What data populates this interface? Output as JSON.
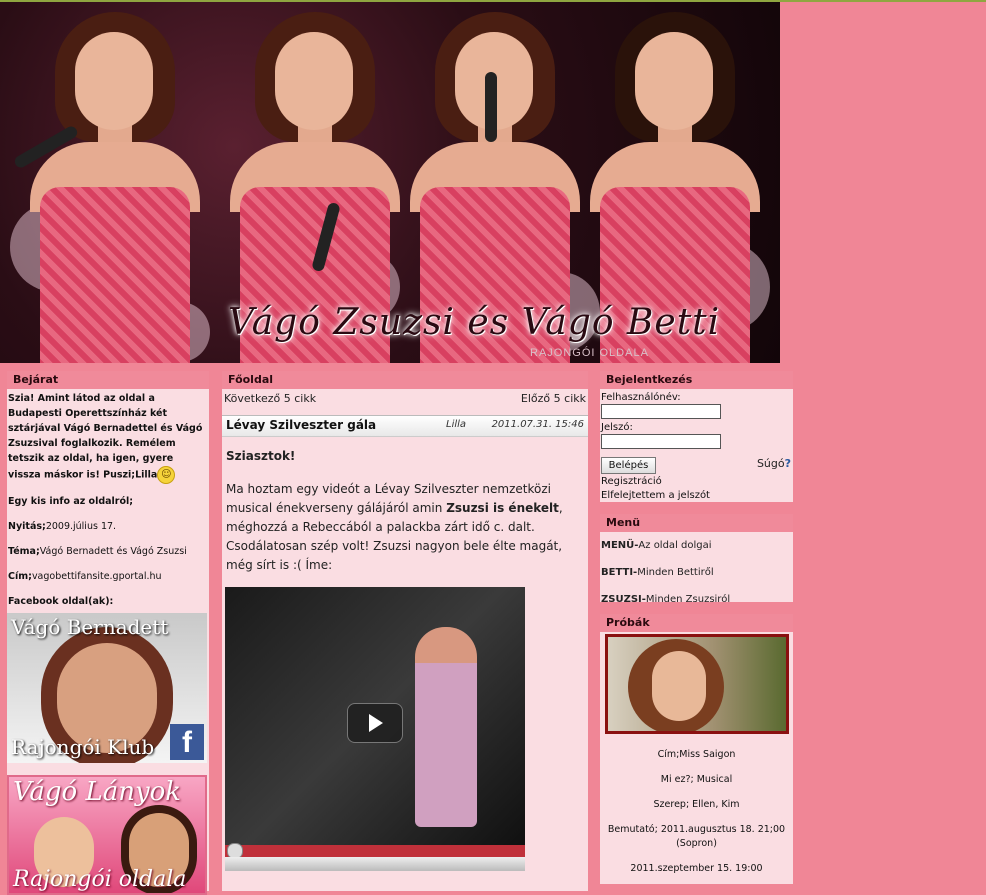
{
  "banner": {
    "title": "Vágó Zsuzsi és Vágó Betti",
    "subtitle": "RAJONGÓI OLDALA"
  },
  "left": {
    "heading": "Bejárat",
    "intro": "Szia! Amint látod az oldal a Budapesti Operettszínház két sztárjával Vágó Bernadettel és Vágó Zsuzsival foglalkozik. Remélem tetszik az oldal, ha igen, gyere vissza máskor is! Puszi;Lilla",
    "info_title": "Egy kis info az oldalról;",
    "opening_label": "Nyitás;",
    "opening_value": "2009.július 17.",
    "theme_label": "Téma;",
    "theme_value": "Vágó Bernadett és Vágó Zsuzsi",
    "address_label": "Cím;",
    "address_value": "vagobettifansite.gportal.hu",
    "facebook_label": "Facebook oldal(ak):",
    "fb1_top": "Vágó Bernadett",
    "fb1_bottom": "Rajongói Klub",
    "fb2_top": "Vágó Lányok",
    "fb2_bottom": "Rajongói oldala"
  },
  "main": {
    "heading": "Főoldal",
    "next_label": "Következő 5 cikk",
    "prev_label": "Előző 5 cikk",
    "post": {
      "title": "Lévay Szilveszter gála",
      "author": "Lilla",
      "date": "2011.07.31. 15:46",
      "greeting": "Sziasztok!",
      "body_before": "Ma hoztam egy videót a Lévay Szilveszter nemzetközi musical énekverseny gálájáról amin ",
      "body_bold": "Zsuzsi is énekelt",
      "body_after": ", méghozzá a Rebeccából a palackba zárt idő c. dalt. Csodálatosan szép volt! Zsuzsi nagyon bele élte magát, még sírt is :( Íme:"
    }
  },
  "login": {
    "heading": "Bejelentkezés",
    "username_label": "Felhasználónév:",
    "password_label": "Jelszó:",
    "login_button": "Belépés",
    "help_label": "Súgó",
    "register_link": "Regisztráció",
    "forgot_link": "Elfelejtettem a jelszót"
  },
  "menu": {
    "heading": "Menü",
    "items": [
      {
        "key": "MENÜ-",
        "text": "Az oldal dolgai"
      },
      {
        "key": "BETTI-",
        "text": "Minden Bettiről"
      },
      {
        "key": "ZSUZSI-",
        "text": "Minden Zsuzsiról"
      }
    ]
  },
  "rehearsals": {
    "heading": "Próbák",
    "lines": [
      "Cím;Miss Saigon",
      "Mi ez?; Musical",
      "Szerep; Ellen, Kim",
      "Bemutató; 2011.augusztus 18. 21;00 (Sopron)",
      "2011.szeptember 15. 19:00"
    ]
  },
  "colors": {
    "page_background": "#f08696",
    "box_background": "#fadde2",
    "box_header": "#f08a9a"
  }
}
